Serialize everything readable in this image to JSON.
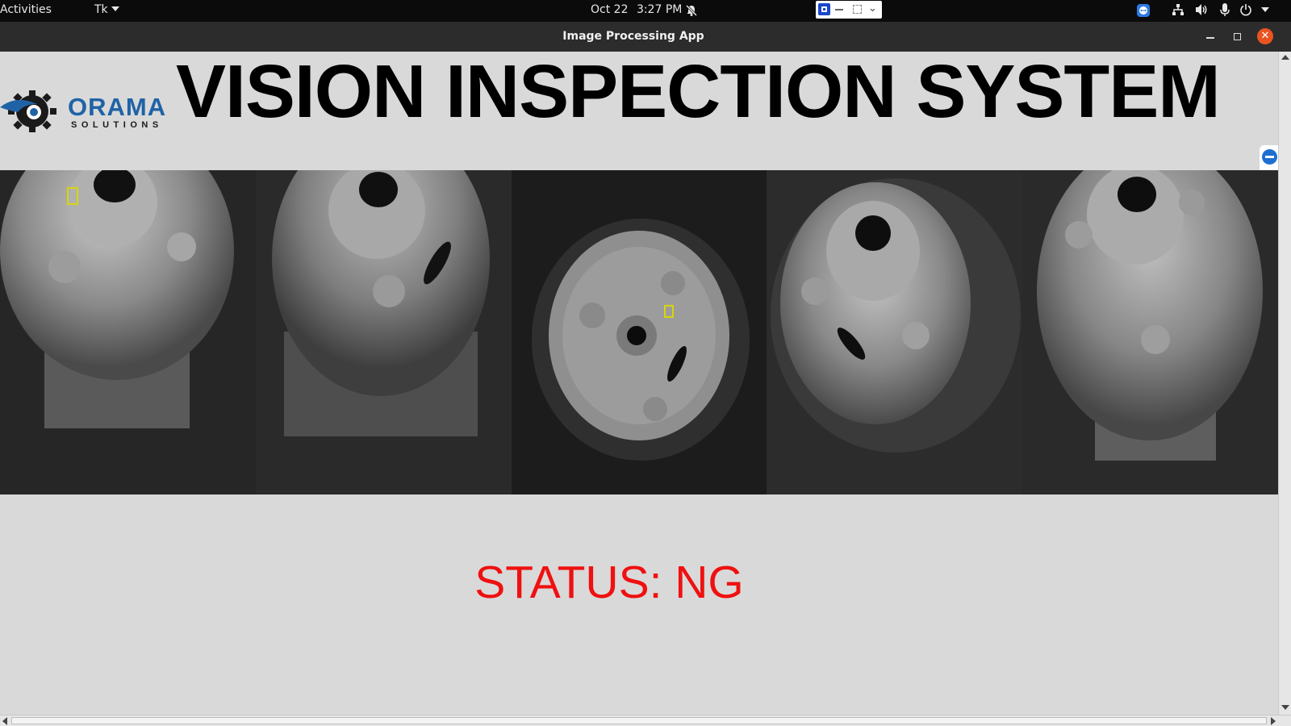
{
  "topbar": {
    "activities": "Activities",
    "app_menu": "Tk",
    "date": "Oct 22",
    "time": "3:27 PM"
  },
  "window": {
    "title": "Image Processing App"
  },
  "logo": {
    "name": "ORAMA",
    "subtitle": "SOLUTIONS",
    "brand_color": "#1f63a6"
  },
  "heading": "VISION INSPECTION SYSTEM",
  "images": [
    {
      "id": "camera-1",
      "defect_marker": true
    },
    {
      "id": "camera-2",
      "defect_marker": false
    },
    {
      "id": "camera-3",
      "defect_marker": true
    },
    {
      "id": "camera-4",
      "defect_marker": false
    },
    {
      "id": "camera-5",
      "defect_marker": false
    }
  ],
  "status": {
    "text": "STATUS: NG",
    "color": "#f01010"
  },
  "icons": {
    "notifications": "bell-muted-icon",
    "teamviewer": "teamviewer-icon",
    "network": "network-icon",
    "volume": "volume-icon",
    "microphone": "microphone-icon",
    "power": "power-icon"
  }
}
